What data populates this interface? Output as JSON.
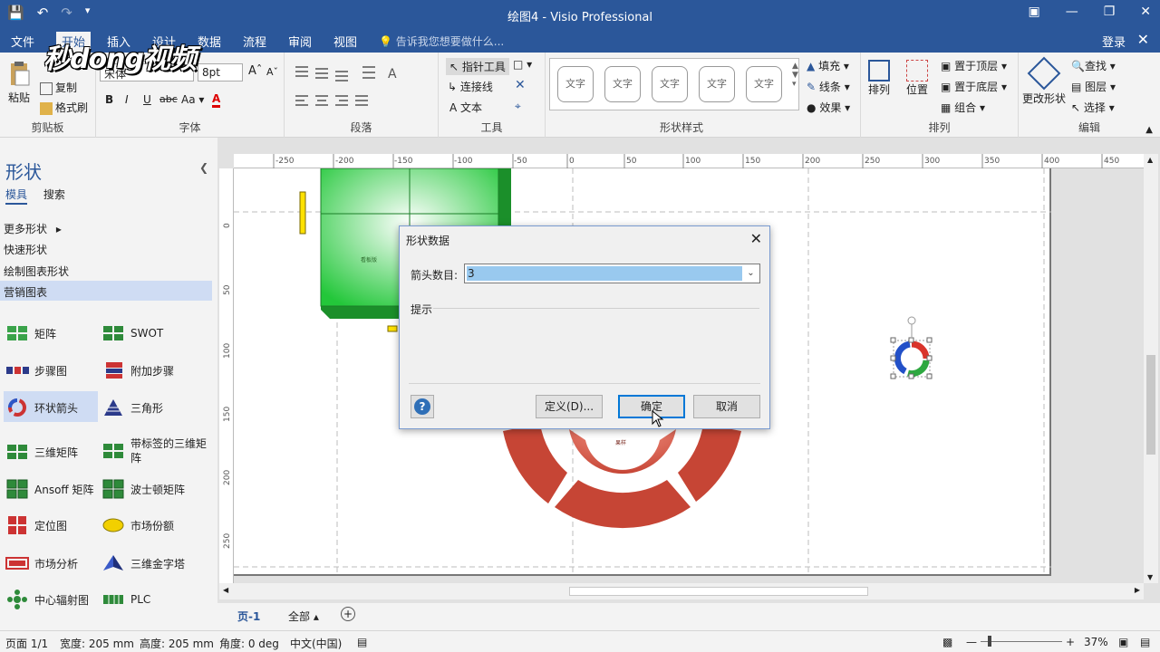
{
  "window": {
    "title": "绘图4 - Visio Professional"
  },
  "menu": {
    "tabs": [
      "文件",
      "开始",
      "插入",
      "设计",
      "数据",
      "流程",
      "审阅",
      "视图"
    ],
    "tell_me": "告诉我您想要做什么...",
    "login": "登录"
  },
  "watermark": "秒dong视频",
  "ribbon": {
    "clipboard": {
      "paste": "粘贴",
      "copy": "复制",
      "format_painter": "格式刷",
      "label": "剪贴板"
    },
    "font": {
      "font_name": "宋体",
      "font_size": "8pt",
      "label": "字体"
    },
    "paragraph": {
      "label": "段落"
    },
    "tools": {
      "pointer": "指针工具",
      "connector": "连接线",
      "text": "文本",
      "label": "工具"
    },
    "shape_styles": {
      "items": [
        "文字",
        "文字",
        "文字",
        "文字",
        "文字"
      ],
      "label": "形状样式"
    },
    "shape_fmt": {
      "fill": "填充",
      "line": "线条",
      "effect": "效果"
    },
    "arrange": {
      "arrange": "排列",
      "position": "位置",
      "bring_front": "置于顶层",
      "send_back": "置于底层",
      "group": "组合",
      "label": "排列"
    },
    "edit": {
      "change_shape": "更改形状",
      "find": "查找",
      "layers": "图层",
      "select": "选择",
      "label": "编辑"
    }
  },
  "shapes_panel": {
    "title": "形状",
    "tabs": [
      "模具",
      "搜索"
    ],
    "links": [
      "更多形状",
      "快速形状",
      "绘制图表形状",
      "营销图表"
    ],
    "stencils": [
      {
        "label": "矩阵",
        "icon": "matrix-icon"
      },
      {
        "label": "SWOT",
        "icon": "swot-icon"
      },
      {
        "label": "步骤图",
        "icon": "steps-icon"
      },
      {
        "label": "附加步骤",
        "icon": "additional-steps-icon"
      },
      {
        "label": "环状箭头",
        "icon": "circular-arrows-icon"
      },
      {
        "label": "三角形",
        "icon": "triangle-icon"
      },
      {
        "label": "三维矩阵",
        "icon": "3d-matrix-icon"
      },
      {
        "label": "带标签的三维矩阵",
        "icon": "labeled-3d-matrix-icon"
      },
      {
        "label": "Ansoff 矩阵",
        "icon": "ansoff-matrix-icon"
      },
      {
        "label": "波士顿矩阵",
        "icon": "boston-matrix-icon"
      },
      {
        "label": "定位图",
        "icon": "positioning-icon"
      },
      {
        "label": "市场份额",
        "icon": "market-share-icon"
      },
      {
        "label": "市场分析",
        "icon": "market-analysis-icon"
      },
      {
        "label": "三维金字塔",
        "icon": "3d-pyramid-icon"
      },
      {
        "label": "中心辐射图",
        "icon": "hub-spoke-icon"
      },
      {
        "label": "PLC",
        "icon": "plc-icon"
      }
    ]
  },
  "ruler": {
    "h_ticks": [
      "-250",
      "-200",
      "-150",
      "-100",
      "-50",
      "0",
      "50",
      "100",
      "150",
      "200",
      "250",
      "300",
      "350",
      "400",
      "450"
    ],
    "v_ticks": [
      "0",
      "50",
      "100",
      "150",
      "200",
      "250"
    ]
  },
  "canvas_labels": {
    "green_box": "看板版",
    "red_center": "果样"
  },
  "dialog": {
    "title": "形状数据",
    "field_label": "箭头数目:",
    "field_value": "3",
    "hint_label": "提示",
    "define_button": "定义(D)...",
    "ok_button": "确定",
    "cancel_button": "取消"
  },
  "page_tabs": {
    "page": "页-1",
    "all": "全部"
  },
  "status": {
    "page": "页面 1/1",
    "width": "宽度: 205 mm",
    "height": "高度: 205 mm",
    "angle": "角度: 0 deg",
    "lang": "中文(中国)",
    "zoom": "37%"
  }
}
